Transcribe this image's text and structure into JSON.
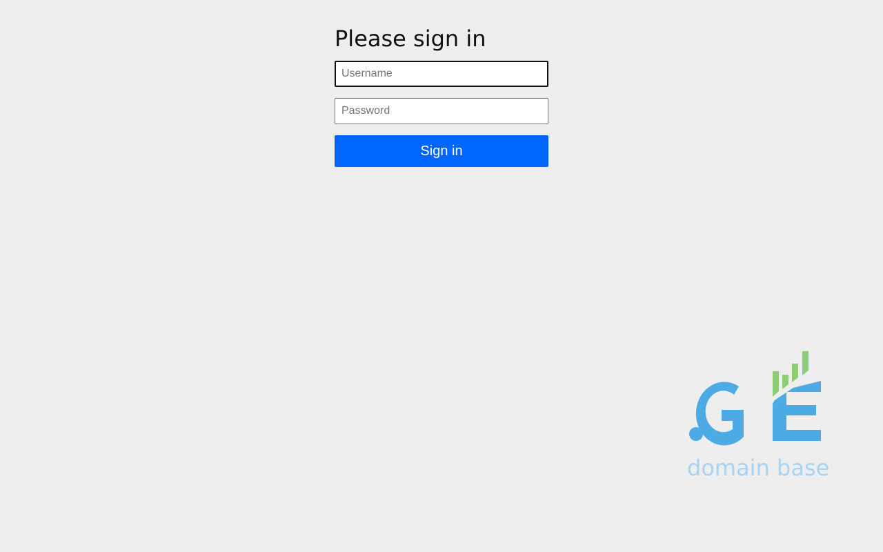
{
  "login": {
    "title": "Please sign in",
    "username_placeholder": "Username",
    "password_placeholder": "Password",
    "signin_label": "Sign in"
  },
  "logo": {
    "mark": ".GE",
    "tagline": "domain base",
    "colors": {
      "mark": "#4cabe5",
      "bars": "#8dcd75",
      "tagline": "#a9d3f2"
    }
  },
  "colors": {
    "background": "#eeeeee",
    "button": "#0066ff",
    "button_text": "#ffffff"
  }
}
